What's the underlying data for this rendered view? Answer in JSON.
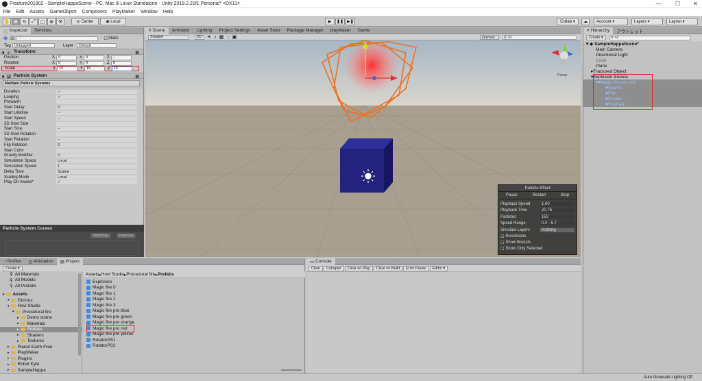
{
  "window": {
    "title": "Fracture201902 - SampleHappaScene - PC, Mac & Linux Standalone - Unity 2019.2.21f1 Personal* <DX11>"
  },
  "menu": [
    "File",
    "Edit",
    "Assets",
    "GameObject",
    "Component",
    "PlayMaker",
    "Window",
    "Help"
  ],
  "toolbar": {
    "pivot_label": "Center",
    "space_label": "Local",
    "collab_label": "Collab",
    "account_label": "Account",
    "layers_label": "Layers",
    "layout_label": "Layout"
  },
  "inspector": {
    "tabs": [
      "Inspector",
      "Services"
    ],
    "static_label": "Static",
    "tag_label": "Tag",
    "tag_value": "Untagged",
    "layer_label": "Layer",
    "layer_value": "Default",
    "transform_title": "Transform",
    "position_label": "Position",
    "rotation_label": "Rotation",
    "scale_label": "Scale",
    "pos": {
      "x": "0",
      "y": "0",
      "z": "--"
    },
    "rot": {
      "x": "0",
      "y": "0",
      "z": "0"
    },
    "scale": {
      "x": "15",
      "y": "15",
      "z": "15"
    },
    "ps_title": "Particle System",
    "multi_label": "Multiple Particle Systems",
    "params": [
      {
        "label": "Duration",
        "value": "--"
      },
      {
        "label": "Looping",
        "value": "✓"
      },
      {
        "label": "Prewarm",
        "value": ""
      },
      {
        "label": "Start Delay",
        "value": "0"
      },
      {
        "label": "Start Lifetime",
        "value": "--"
      },
      {
        "label": "Start Speed",
        "value": "--"
      },
      {
        "label": "3D Start Size",
        "value": ""
      },
      {
        "label": "Start Size",
        "value": "--"
      },
      {
        "label": "3D Start Rotation",
        "value": ""
      },
      {
        "label": "Start Rotation",
        "value": "--"
      },
      {
        "label": "Flip Rotation",
        "value": "0"
      },
      {
        "label": "Start Color",
        "value": ""
      },
      {
        "label": "Gravity Modifier",
        "value": "0"
      },
      {
        "label": "Simulation Space",
        "value": "Local"
      },
      {
        "label": "Simulation Speed",
        "value": "1"
      },
      {
        "label": "Delta Time",
        "value": "Scaled"
      },
      {
        "label": "Scaling Mode",
        "value": "Local"
      },
      {
        "label": "Play On Awake*",
        "value": "✓"
      }
    ],
    "curves_title": "Particle System Curves",
    "optimize_label": "Optimize",
    "remove_label": "Remove"
  },
  "scene": {
    "tabs": [
      "Scene",
      "Animator",
      "Lighting",
      "Project Settings",
      "Asset Store",
      "Package Manager",
      "playMaker",
      "Game"
    ],
    "shading": "Shaded",
    "mode_2d": "2D",
    "gizmos": "Gizmos",
    "search_placeholder": "All",
    "persp_label": "Persp"
  },
  "particle_effect": {
    "title": "Particle Effect",
    "pause": "Pause",
    "restart": "Restart",
    "stop": "Stop",
    "rows": [
      {
        "label": "Playback Speed",
        "value": "1.00"
      },
      {
        "label": "Playback Time",
        "value": "20.76"
      },
      {
        "label": "Particles",
        "value": "152"
      },
      {
        "label": "Speed Range",
        "value": "0.0 - 5.7"
      },
      {
        "label": "Simulate Layers",
        "value": "Nothing"
      }
    ],
    "resimulate": "Resimulate",
    "show_bounds": "Show Bounds",
    "show_only_selected": "Show Only Selected"
  },
  "hierarchy": {
    "title": "Hierarchy",
    "title2": "アウトレット",
    "create_label": "Create",
    "search_placeholder": "All",
    "scene_name": "SampleHappaScene*",
    "items": [
      {
        "name": "Main Camera",
        "indent": 2,
        "sel": false,
        "dim": false
      },
      {
        "name": "Directional Light",
        "indent": 2,
        "sel": false,
        "dim": false
      },
      {
        "name": "Cube",
        "indent": 2,
        "sel": false,
        "dim": true
      },
      {
        "name": "Plane",
        "indent": 2,
        "sel": false,
        "dim": false
      },
      {
        "name": "Fractured Object",
        "indent": 2,
        "sel": false,
        "dim": false
      },
      {
        "name": "Explosion Source",
        "indent": 2,
        "sel": false,
        "dim": false
      },
      {
        "name": "Magic fire pro red",
        "indent": 3,
        "sel": true,
        "dim": false
      },
      {
        "name": "Sparks",
        "indent": 4,
        "sel": true,
        "dim": false
      },
      {
        "name": "Fire",
        "indent": 4,
        "sel": true,
        "dim": false
      },
      {
        "name": "Smoke",
        "indent": 4,
        "sel": true,
        "dim": false
      },
      {
        "name": "FireDark",
        "indent": 4,
        "sel": true,
        "dim": false
      }
    ]
  },
  "project": {
    "tabs": [
      "Profiler",
      "Animation",
      "Project"
    ],
    "create_label": "Create",
    "favorites": [
      "All Materials",
      "All Models",
      "All Prefabs"
    ],
    "tree": [
      {
        "name": "Assets",
        "indent": 0,
        "bold": true
      },
      {
        "name": "Gizmos",
        "indent": 1,
        "bold": false
      },
      {
        "name": "Hovl Studio",
        "indent": 1,
        "bold": false
      },
      {
        "name": "Procedural fire",
        "indent": 2,
        "bold": false
      },
      {
        "name": "Demo scene",
        "indent": 3,
        "bold": false
      },
      {
        "name": "Materials",
        "indent": 3,
        "bold": false
      },
      {
        "name": "Prefabs",
        "indent": 3,
        "bold": false
      },
      {
        "name": "Shaders",
        "indent": 3,
        "bold": false
      },
      {
        "name": "Textures",
        "indent": 3,
        "bold": false
      },
      {
        "name": "Planet Earth Free",
        "indent": 1,
        "bold": false
      },
      {
        "name": "PlayMaker",
        "indent": 1,
        "bold": false
      },
      {
        "name": "Plugins",
        "indent": 1,
        "bold": false
      },
      {
        "name": "Robot Kyle",
        "indent": 1,
        "bold": false
      },
      {
        "name": "SampleHappa",
        "indent": 1,
        "bold": false
      }
    ],
    "breadcrumb": [
      "Assets",
      "Hovl Studio",
      "Procedural fire",
      "Prefabs"
    ],
    "files": [
      "Explosion",
      "Magic fire 0",
      "Magic fire 1",
      "Magic fire 2",
      "Magic fire 3",
      "Magic fire pro blue",
      "Magic fire pro green",
      "Magic fire pro orange",
      "Magic fire pro red",
      "Magic fire pro yellow",
      "RotatorPS1",
      "RotatorPS2"
    ]
  },
  "console": {
    "title": "Console",
    "buttons": [
      "Clear",
      "Collapse",
      "Clear on Play",
      "Clear on Build",
      "Error Pause",
      "Editor"
    ]
  },
  "status": {
    "text": "Auto Generate Lighting Off"
  }
}
